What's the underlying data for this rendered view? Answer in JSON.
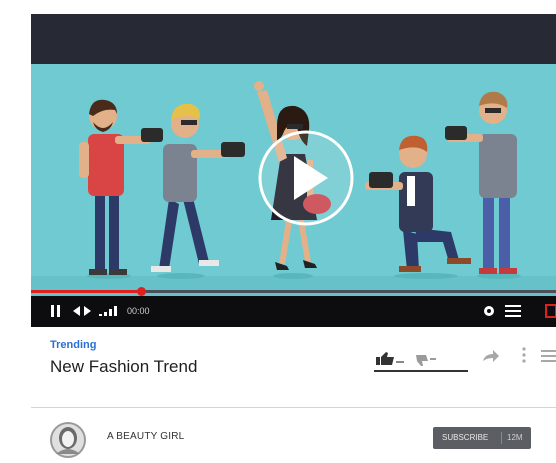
{
  "video": {
    "time_current": "00:00",
    "progress": 0.21,
    "play_button": "play-icon"
  },
  "info": {
    "category": "Trending",
    "title": "New Fashion Trend"
  },
  "channel": {
    "name": "A BEAUTY GIRL",
    "subscribe_label": "SUBSCRIBE",
    "subscriber_count": "12M"
  },
  "colors": {
    "accent": "#e0201e",
    "link": "#2a6fd3",
    "video_bg": "#6fcad1",
    "top_bar": "#272a35"
  }
}
